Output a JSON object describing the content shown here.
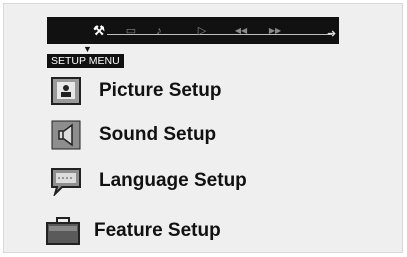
{
  "toolbar": {
    "icons": [
      {
        "name": "setup-icon",
        "glyph": "⚒"
      },
      {
        "name": "subtitle-icon",
        "glyph": "▭"
      },
      {
        "name": "audio-icon",
        "glyph": "♪"
      },
      {
        "name": "play-icon",
        "glyph": "▷"
      },
      {
        "name": "rewind-icon",
        "glyph": "◀◀"
      },
      {
        "name": "fast-forward-icon",
        "glyph": "▶▶"
      }
    ]
  },
  "menu": {
    "title": "SETUP MENU",
    "items": [
      {
        "label": "Picture Setup",
        "icon": "picture-icon"
      },
      {
        "label": "Sound Setup",
        "icon": "speaker-icon"
      },
      {
        "label": "Language Setup",
        "icon": "speech-bubble-icon"
      },
      {
        "label": "Feature Setup",
        "icon": "toolbox-icon"
      }
    ]
  }
}
